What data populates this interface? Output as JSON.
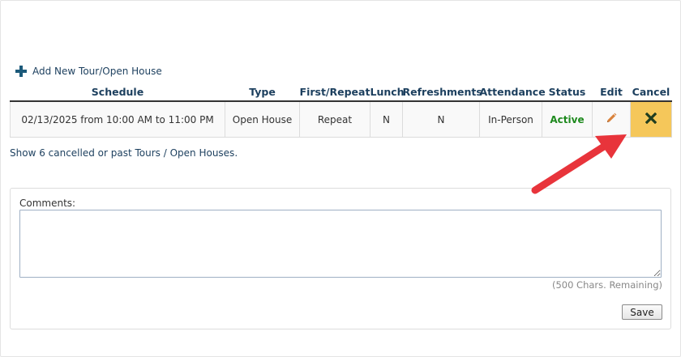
{
  "toolbar": {
    "add_label": "Add New Tour/Open House"
  },
  "table": {
    "headers": [
      "Schedule",
      "Type",
      "First/Repeat",
      "Lunch",
      "Refreshments",
      "Attendance",
      "Status",
      "Edit",
      "Cancel"
    ],
    "rows": [
      {
        "schedule": "02/13/2025 from 10:00 AM to 11:00 PM",
        "type": "Open House",
        "first_repeat": "Repeat",
        "lunch": "N",
        "refreshments": "N",
        "attendance": "In-Person",
        "status": "Active"
      }
    ]
  },
  "show_link": "Show 6 cancelled or past Tours / Open Houses.",
  "comments": {
    "label": "Comments:",
    "value": "",
    "remaining": "(500 Chars. Remaining)",
    "save_label": "Save"
  },
  "icons": {
    "add": "plus-icon",
    "edit": "pencil-icon",
    "cancel": "x-icon",
    "annotation": "red-arrow"
  },
  "colors": {
    "header_text": "#1c3f5e",
    "status_active": "#1e8a1e",
    "cancel_bg": "#f5c75a",
    "pencil": "#d9823b",
    "arrow": "#e8343b"
  }
}
